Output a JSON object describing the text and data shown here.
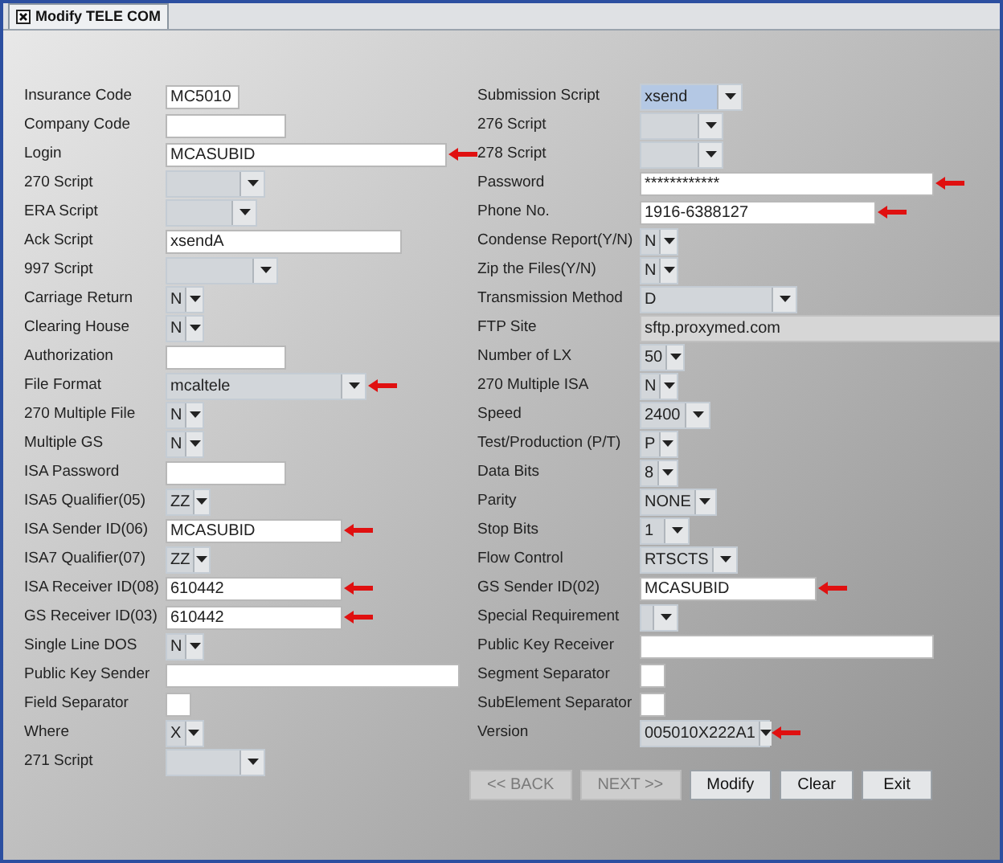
{
  "window": {
    "title": "Modify TELE COM"
  },
  "left_fields": [
    {
      "label": "Insurance Code",
      "kind": "text",
      "value": "MC5010",
      "arrow": false
    },
    {
      "label": "Company Code",
      "kind": "text",
      "arrow": false
    },
    {
      "label": "Login",
      "kind": "text",
      "value": "MCASUBID",
      "arrow": true
    },
    {
      "label": "270 Script",
      "kind": "select",
      "arrow": false
    },
    {
      "label": "ERA Script",
      "kind": "select",
      "arrow": false
    },
    {
      "label": "Ack Script",
      "kind": "text",
      "value": "xsendA",
      "arrow": false
    },
    {
      "label": "997 Script",
      "kind": "select",
      "arrow": false
    },
    {
      "label": "Carriage Return",
      "kind": "select",
      "value": "N",
      "arrow": false
    },
    {
      "label": "Clearing House",
      "kind": "select",
      "value": "N",
      "arrow": false
    },
    {
      "label": "Authorization",
      "kind": "text",
      "arrow": false
    },
    {
      "label": "File Format",
      "kind": "select",
      "value": "mcaltele",
      "arrow": true
    },
    {
      "label": "270 Multiple File",
      "kind": "select",
      "value": "N",
      "arrow": false
    },
    {
      "label": "Multiple GS",
      "kind": "select",
      "value": "N",
      "arrow": false
    },
    {
      "label": "ISA Password",
      "kind": "text",
      "arrow": false
    },
    {
      "label": "ISA5 Qualifier(05)",
      "kind": "select",
      "value": "ZZ",
      "arrow": false
    },
    {
      "label": "ISA Sender ID(06)",
      "kind": "text",
      "value": "MCASUBID",
      "arrow": true
    },
    {
      "label": "ISA7 Qualifier(07)",
      "kind": "select",
      "value": "ZZ",
      "arrow": false
    },
    {
      "label": "ISA Receiver ID(08)",
      "kind": "text",
      "value": "610442",
      "arrow": true
    },
    {
      "label": "GS Receiver ID(03)",
      "kind": "text",
      "value": "610442",
      "arrow": true
    },
    {
      "label": "Single Line DOS",
      "kind": "select",
      "value": "N",
      "arrow": false
    },
    {
      "label": "Public Key Sender",
      "kind": "text",
      "arrow": false
    },
    {
      "label": "Field Separator",
      "kind": "text",
      "arrow": false
    },
    {
      "label": "Where",
      "kind": "select",
      "value": "X",
      "arrow": false
    },
    {
      "label": "271 Script",
      "kind": "select",
      "arrow": false
    }
  ],
  "right_fields": [
    {
      "label": "Submission Script",
      "kind": "select",
      "value": "xsend",
      "arrow": false,
      "selected": true
    },
    {
      "label": "276 Script",
      "kind": "select",
      "arrow": false,
      "selected": false
    },
    {
      "label": "278 Script",
      "kind": "select",
      "arrow": false,
      "selected": false
    },
    {
      "label": "Password",
      "kind": "text",
      "value": "************",
      "arrow": true
    },
    {
      "label": "Phone No.",
      "kind": "text",
      "value": "1916-6388127",
      "arrow": true
    },
    {
      "label": "Condense Report(Y/N)",
      "kind": "select",
      "value": "N",
      "arrow": false,
      "selected": false
    },
    {
      "label": "Zip the Files(Y/N)",
      "kind": "select",
      "value": "N",
      "arrow": false,
      "selected": false
    },
    {
      "label": "Transmission Method",
      "kind": "select",
      "value": "D",
      "arrow": false,
      "selected": false
    },
    {
      "label": "FTP Site",
      "kind": "readonly",
      "value": "sftp.proxymed.com"
    },
    {
      "label": "Number of LX",
      "kind": "select",
      "value": "50",
      "arrow": false,
      "selected": false
    },
    {
      "label": "270 Multiple ISA",
      "kind": "select",
      "value": "N",
      "arrow": false,
      "selected": false
    },
    {
      "label": "Speed",
      "kind": "select",
      "value": "2400",
      "arrow": false,
      "selected": false
    },
    {
      "label": "Test/Production (P/T)",
      "kind": "select",
      "value": "P",
      "arrow": false,
      "selected": false
    },
    {
      "label": "Data Bits",
      "kind": "select",
      "value": "8",
      "arrow": false,
      "selected": false
    },
    {
      "label": "Parity",
      "kind": "select",
      "value": "NONE",
      "arrow": false,
      "selected": false
    },
    {
      "label": "Stop Bits",
      "kind": "select",
      "value": "1",
      "arrow": false,
      "selected": false
    },
    {
      "label": "Flow Control",
      "kind": "select",
      "value": "RTSCTS",
      "arrow": false,
      "selected": false
    },
    {
      "label": "GS Sender ID(02)",
      "kind": "text",
      "value": "MCASUBID",
      "arrow": true
    },
    {
      "label": "Special Requirement",
      "kind": "select",
      "arrow": false,
      "selected": false
    },
    {
      "label": "Public Key Receiver",
      "kind": "text",
      "arrow": false
    },
    {
      "label": "Segment Separator",
      "kind": "text",
      "arrow": false
    },
    {
      "label": "SubElement Separator",
      "kind": "text",
      "arrow": false
    },
    {
      "label": "Version",
      "kind": "select",
      "value": "005010X222A1",
      "arrow": true,
      "selected": false
    }
  ],
  "buttons": [
    {
      "label": "<< BACK",
      "disabled": true
    },
    {
      "label": "NEXT >>",
      "disabled": true
    },
    {
      "label": "Modify",
      "disabled": false
    },
    {
      "label": "Clear",
      "disabled": false
    },
    {
      "label": "Exit",
      "disabled": false
    }
  ]
}
